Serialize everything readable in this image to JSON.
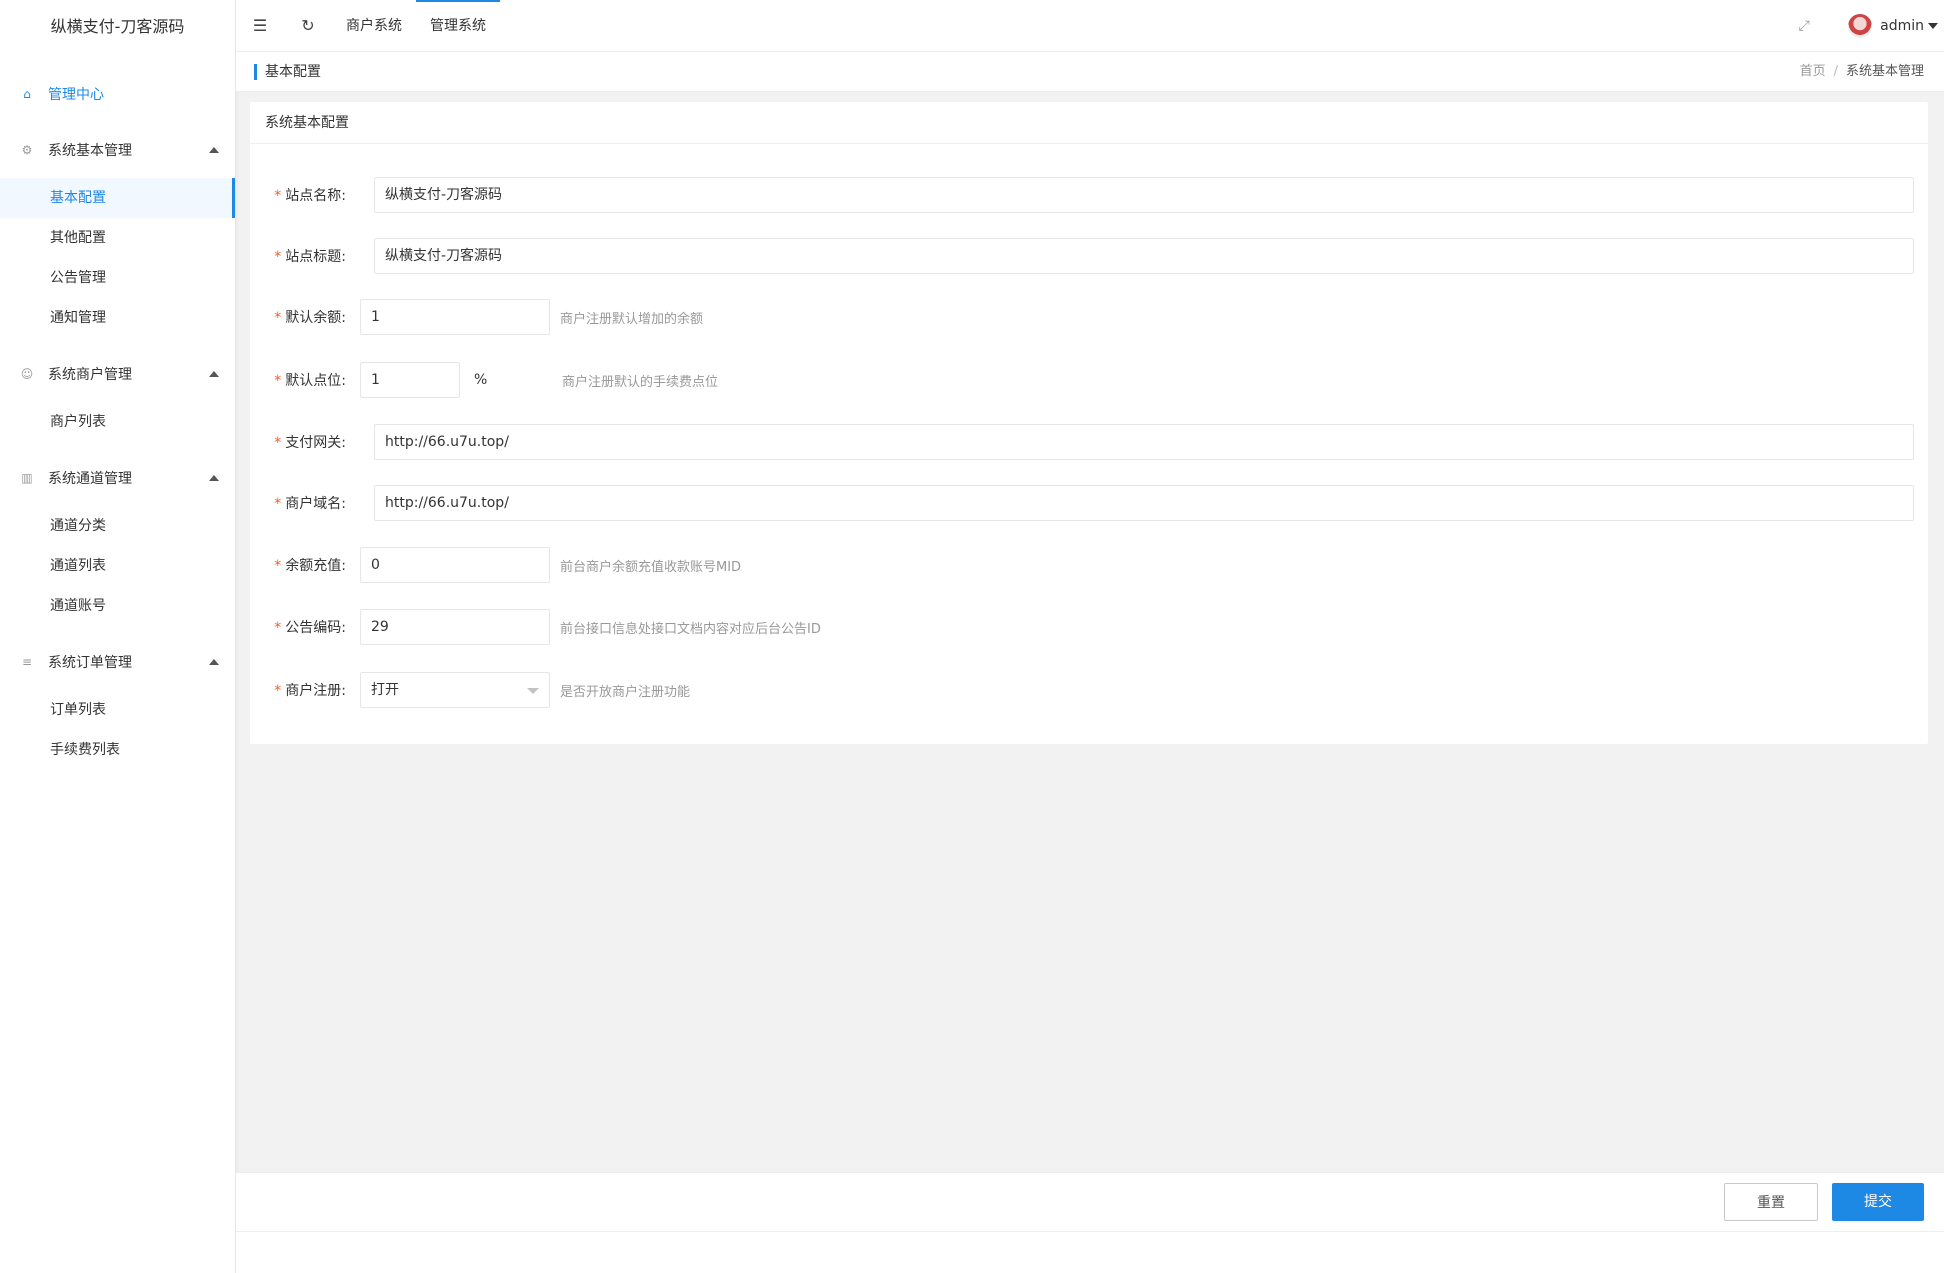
{
  "app": {
    "title": "纵横支付-刀客源码"
  },
  "sidebar": {
    "home": {
      "label": "管理中心",
      "icon": "home-icon"
    },
    "groups": [
      {
        "label": "系统基本管理",
        "icon": "gear-icon",
        "items": [
          "基本配置",
          "其他配置",
          "公告管理",
          "通知管理"
        ]
      },
      {
        "label": "系统商户管理",
        "icon": "user-icon",
        "items": [
          "商户列表"
        ]
      },
      {
        "label": "系统通道管理",
        "icon": "table-icon",
        "items": [
          "通道分类",
          "通道列表",
          "通道账号"
        ]
      },
      {
        "label": "系统订单管理",
        "icon": "list-icon",
        "items": [
          "订单列表",
          "手续费列表"
        ]
      }
    ],
    "active_item": "基本配置"
  },
  "topbar": {
    "tabs": [
      "商户系统",
      "管理系统"
    ],
    "active_tab": "管理系统",
    "user": "admin"
  },
  "subheader": {
    "title": "基本配置",
    "breadcrumb": [
      "首页",
      "系统基本管理"
    ]
  },
  "card": {
    "title": "系统基本配置",
    "fields": {
      "site_name": {
        "label": "站点名称:",
        "value": "纵横支付-刀客源码"
      },
      "site_title": {
        "label": "站点标题:",
        "value": "纵横支付-刀客源码"
      },
      "default_balance": {
        "label": "默认余额:",
        "value": "1",
        "hint": "商户注册默认增加的余额"
      },
      "default_rate": {
        "label": "默认点位:",
        "value": "1",
        "unit": "%",
        "hint": "商户注册默认的手续费点位"
      },
      "pay_gateway": {
        "label": "支付网关:",
        "value": "http://66.u7u.top/"
      },
      "merchant_domain": {
        "label": "商户域名:",
        "value": "http://66.u7u.top/"
      },
      "balance_recharge": {
        "label": "余额充值:",
        "value": "0",
        "hint": "前台商户余额充值收款账号MID"
      },
      "notice_code": {
        "label": "公告编码:",
        "value": "29",
        "hint": "前台接口信息处接口文档内容对应后台公告ID"
      },
      "merchant_register": {
        "label": "商户注册:",
        "value": "打开",
        "hint": "是否开放商户注册功能"
      }
    }
  },
  "footer": {
    "reset": "重置",
    "submit": "提交"
  },
  "colors": {
    "accent": "#1e88e5",
    "required": "#ff5722"
  }
}
